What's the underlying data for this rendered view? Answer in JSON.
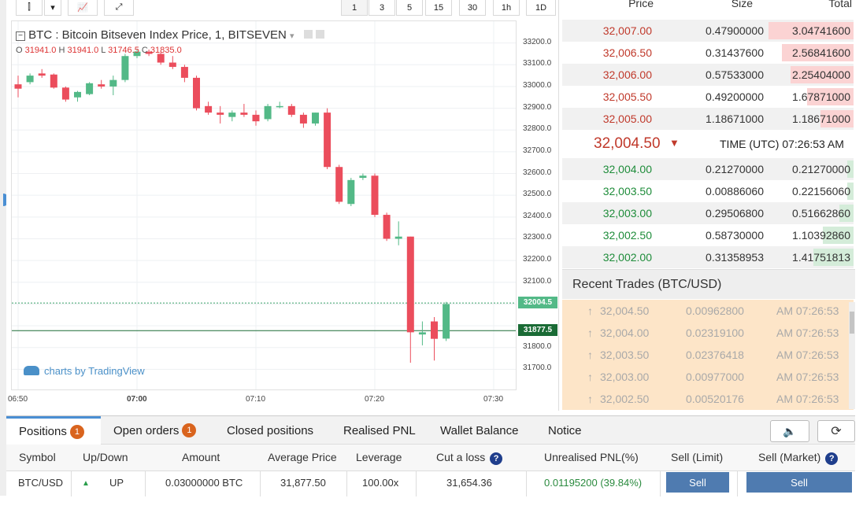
{
  "toolbar": {
    "intervals": [
      "1",
      "3",
      "5",
      "15",
      "30",
      "1h",
      "1D"
    ],
    "active_interval": "1"
  },
  "chart": {
    "symbol_title": "BTC : Bitcoin Bitseven Index Price, 1, BITSEVEN",
    "ohlc": {
      "o_label": "O",
      "o_value": "31941.0",
      "h_label": "H",
      "h_value": "31941.0",
      "l_label": "L",
      "l_value": "31746.5",
      "c_label": "C",
      "c_value": "31835.0"
    },
    "watermark": "charts by TradingView",
    "price_axis": [
      "33200.0",
      "33100.0",
      "33000.0",
      "32900.0",
      "32800.0",
      "32700.0",
      "32600.0",
      "32500.0",
      "32400.0",
      "32300.0",
      "32200.0",
      "32100.0",
      "31800.0",
      "31700.0"
    ],
    "time_axis": [
      "06:50",
      "07:00",
      "07:10",
      "07:20",
      "07:30"
    ],
    "current_price_label": "32004.5",
    "position_price_label": "31877.5",
    "colors": {
      "up": "#53b987",
      "down": "#eb4d5c",
      "current_line": "#3aa36a",
      "position_line": "#1a6b35"
    }
  },
  "chart_data": {
    "type": "candlestick",
    "y_unit": "USD",
    "ylim": [
      31650,
      33250
    ],
    "current_price": 32004.5,
    "position_price": 31877.5,
    "candles": [
      {
        "time": "06:50",
        "o": 33010,
        "h": 33050,
        "l": 32950,
        "c": 32990
      },
      {
        "time": "06:51",
        "o": 33020,
        "h": 33060,
        "l": 33010,
        "c": 33050
      },
      {
        "time": "06:52",
        "o": 33060,
        "h": 33080,
        "l": 33040,
        "c": 33050
      },
      {
        "time": "06:53",
        "o": 33055,
        "h": 33060,
        "l": 32990,
        "c": 32995
      },
      {
        "time": "06:54",
        "o": 32995,
        "h": 33000,
        "l": 32930,
        "c": 32940
      },
      {
        "time": "06:55",
        "o": 32950,
        "h": 32980,
        "l": 32930,
        "c": 32975
      },
      {
        "time": "06:56",
        "o": 32965,
        "h": 33020,
        "l": 32960,
        "c": 33015
      },
      {
        "time": "06:57",
        "o": 33010,
        "h": 33030,
        "l": 32990,
        "c": 33000
      },
      {
        "time": "06:58",
        "o": 33000,
        "h": 33050,
        "l": 32960,
        "c": 33030
      },
      {
        "time": "06:59",
        "o": 33030,
        "h": 33150,
        "l": 33020,
        "c": 33140
      },
      {
        "time": "07:00",
        "o": 33140,
        "h": 33170,
        "l": 33130,
        "c": 33160
      },
      {
        "time": "07:01",
        "o": 33160,
        "h": 33170,
        "l": 33140,
        "c": 33150
      },
      {
        "time": "07:02",
        "o": 33150,
        "h": 33160,
        "l": 33100,
        "c": 33110
      },
      {
        "time": "07:03",
        "o": 33110,
        "h": 33140,
        "l": 33080,
        "c": 33090
      },
      {
        "time": "07:04",
        "o": 33090,
        "h": 33100,
        "l": 33020,
        "c": 33040
      },
      {
        "time": "07:05",
        "o": 33040,
        "h": 33050,
        "l": 32890,
        "c": 32900
      },
      {
        "time": "07:06",
        "o": 32910,
        "h": 32930,
        "l": 32870,
        "c": 32880
      },
      {
        "time": "07:07",
        "o": 32880,
        "h": 32910,
        "l": 32830,
        "c": 32870
      },
      {
        "time": "07:08",
        "o": 32860,
        "h": 32890,
        "l": 32840,
        "c": 32880
      },
      {
        "time": "07:09",
        "o": 32880,
        "h": 32920,
        "l": 32860,
        "c": 32870
      },
      {
        "time": "07:10",
        "o": 32870,
        "h": 32890,
        "l": 32820,
        "c": 32840
      },
      {
        "time": "07:11",
        "o": 32850,
        "h": 32920,
        "l": 32840,
        "c": 32910
      },
      {
        "time": "07:12",
        "o": 32910,
        "h": 32930,
        "l": 32900,
        "c": 32910
      },
      {
        "time": "07:13",
        "o": 32910,
        "h": 32920,
        "l": 32860,
        "c": 32870
      },
      {
        "time": "07:14",
        "o": 32870,
        "h": 32880,
        "l": 32810,
        "c": 32830
      },
      {
        "time": "07:15",
        "o": 32830,
        "h": 32880,
        "l": 32820,
        "c": 32880
      },
      {
        "time": "07:16",
        "o": 32880,
        "h": 32900,
        "l": 32620,
        "c": 32630
      },
      {
        "time": "07:17",
        "o": 32630,
        "h": 32640,
        "l": 32460,
        "c": 32470
      },
      {
        "time": "07:18",
        "o": 32460,
        "h": 32580,
        "l": 32450,
        "c": 32570
      },
      {
        "time": "07:19",
        "o": 32580,
        "h": 32600,
        "l": 32570,
        "c": 32590
      },
      {
        "time": "07:20",
        "o": 32590,
        "h": 32600,
        "l": 32400,
        "c": 32410
      },
      {
        "time": "07:21",
        "o": 32410,
        "h": 32420,
        "l": 32290,
        "c": 32300
      },
      {
        "time": "07:22",
        "o": 32300,
        "h": 32380,
        "l": 32270,
        "c": 32310
      },
      {
        "time": "07:23",
        "o": 32310,
        "h": 32310,
        "l": 31730,
        "c": 31870
      },
      {
        "time": "07:24",
        "o": 31860,
        "h": 31920,
        "l": 31810,
        "c": 31870
      },
      {
        "time": "07:25",
        "o": 31920,
        "h": 31940,
        "l": 31740,
        "c": 31840
      },
      {
        "time": "07:26",
        "o": 31841,
        "h": 32010,
        "l": 31830,
        "c": 32000
      }
    ]
  },
  "orderbook": {
    "headers": {
      "price": "Price",
      "size": "Size",
      "total": "Total"
    },
    "asks": [
      {
        "price": "32,007.00",
        "size": "0.47900000",
        "total": "3.04741600",
        "depth": 1.0
      },
      {
        "price": "32,006.50",
        "size": "0.31437600",
        "total": "2.56841600",
        "depth": 0.84
      },
      {
        "price": "32,006.00",
        "size": "0.57533000",
        "total": "2.25404000",
        "depth": 0.74
      },
      {
        "price": "32,005.50",
        "size": "0.49200000",
        "total": "1.67871000",
        "depth": 0.55
      },
      {
        "price": "32,005.00",
        "size": "1.18671000",
        "total": "1.18671000",
        "depth": 0.39
      }
    ],
    "last_price": "32,004.50",
    "last_arrow": "▼",
    "time_label": "TIME (UTC) 07:26:53 AM",
    "bids": [
      {
        "price": "32,004.00",
        "size": "0.21270000",
        "total": "0.21270000",
        "depth": 0.07
      },
      {
        "price": "32,003.50",
        "size": "0.00886060",
        "total": "0.22156060",
        "depth": 0.07
      },
      {
        "price": "32,003.00",
        "size": "0.29506800",
        "total": "0.51662860",
        "depth": 0.17
      },
      {
        "price": "32,002.50",
        "size": "0.58730000",
        "total": "1.10392860",
        "depth": 0.36
      },
      {
        "price": "32,002.00",
        "size": "0.31358953",
        "total": "1.41751813",
        "depth": 0.47
      }
    ],
    "colors": {
      "ask_price": "#c0392b",
      "bid_price": "#1e8c3a",
      "ask_bar": "#fbd3d3",
      "bid_bar": "#d4ecd9"
    }
  },
  "recent_trades": {
    "title": "Recent Trades (BTC/USD)",
    "rows": [
      {
        "arrow": "↑",
        "price": "32,004.50",
        "size": "0.00962800",
        "time": "AM 07:26:53"
      },
      {
        "arrow": "↑",
        "price": "32,004.00",
        "size": "0.02319100",
        "time": "AM 07:26:53"
      },
      {
        "arrow": "↑",
        "price": "32,003.50",
        "size": "0.02376418",
        "time": "AM 07:26:53"
      },
      {
        "arrow": "↑",
        "price": "32,003.00",
        "size": "0.00977000",
        "time": "AM 07:26:53"
      },
      {
        "arrow": "↑",
        "price": "32,002.50",
        "size": "0.00520176",
        "time": "AM 07:26:53"
      }
    ]
  },
  "bottom": {
    "tabs": {
      "positions": "Positions",
      "positions_count": "1",
      "open_orders": "Open orders",
      "open_orders_count": "1",
      "closed_positions": "Closed positions",
      "realised_pnl": "Realised PNL",
      "wallet_balance": "Wallet Balance",
      "notice": "Notice"
    },
    "columns": {
      "symbol": "Symbol",
      "updown": "Up/Down",
      "amount": "Amount",
      "avg_price": "Average Price",
      "leverage": "Leverage",
      "cut_loss": "Cut a loss",
      "unrealised": "Unrealised PNL(%)",
      "sell_limit": "Sell (Limit)",
      "sell_market": "Sell (Market)"
    },
    "row": {
      "symbol": "BTC/USD",
      "arrow": "▲",
      "direction": "UP",
      "amount": "0.03000000 BTC",
      "avg_price": "31,877.50",
      "leverage": "100.00x",
      "cut_loss": "31,654.36",
      "unrealised": "0.01195200 (39.84%)",
      "sell_limit": "Sell",
      "sell_market": "Sell"
    }
  }
}
